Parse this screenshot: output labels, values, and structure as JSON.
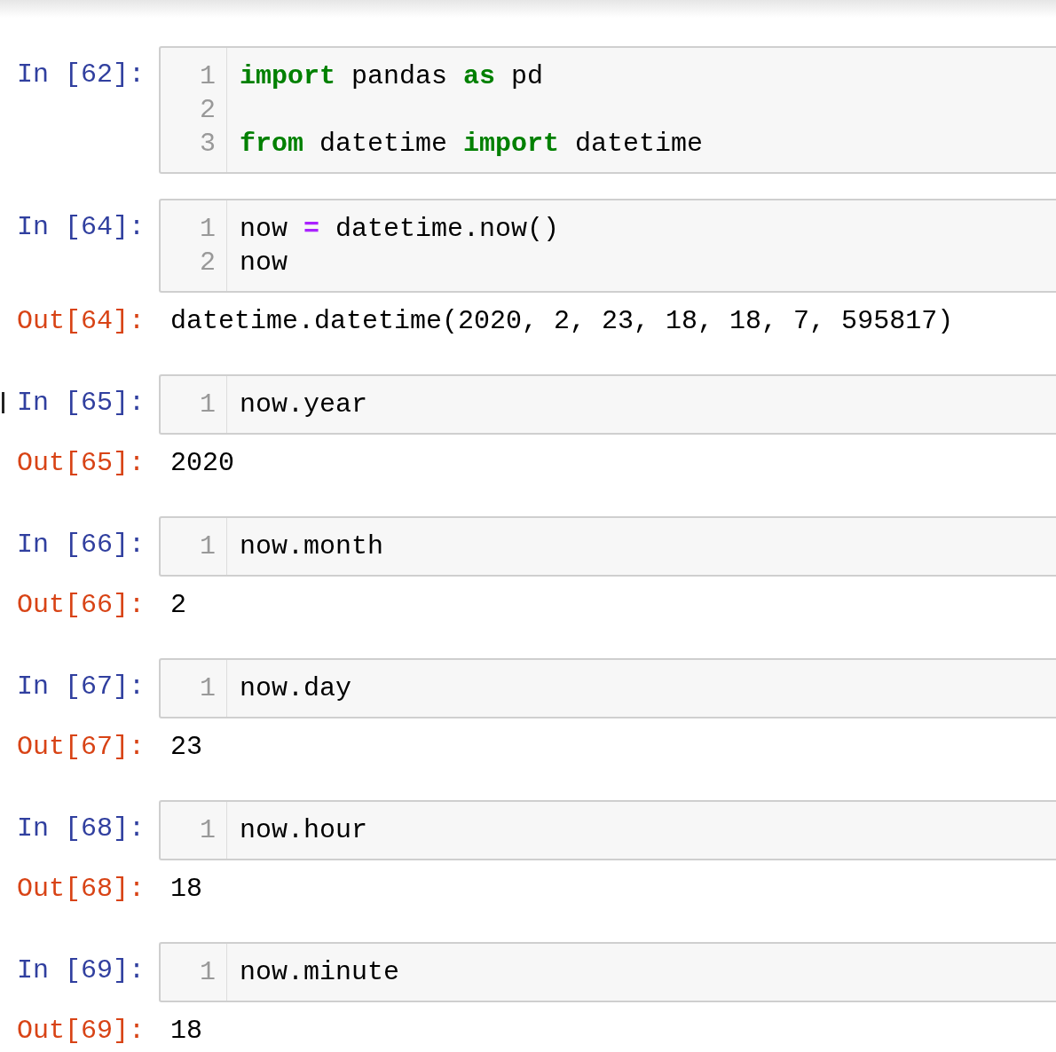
{
  "cells": [
    {
      "prompt": "In [62]:",
      "selected": false,
      "lines": [
        {
          "number": "1",
          "tokens": [
            {
              "text": "import",
              "kind": "keyword"
            },
            {
              "text": " pandas ",
              "kind": "name"
            },
            {
              "text": "as",
              "kind": "keyword"
            },
            {
              "text": " pd",
              "kind": "name"
            }
          ]
        },
        {
          "number": "2"
        },
        {
          "number": "3",
          "tokens": [
            {
              "text": "from",
              "kind": "keyword"
            },
            {
              "text": " datetime ",
              "kind": "name"
            },
            {
              "text": "import",
              "kind": "keyword"
            },
            {
              "text": " datetime",
              "kind": "name"
            }
          ]
        }
      ]
    },
    {
      "prompt": "In [64]:",
      "selected": false,
      "lines": [
        {
          "number": "1",
          "tokens": [
            {
              "text": "now ",
              "kind": "name"
            },
            {
              "text": "=",
              "kind": "operator"
            },
            {
              "text": " datetime.now()",
              "kind": "name"
            }
          ]
        },
        {
          "number": "2",
          "tokens": [
            {
              "text": "now",
              "kind": "name"
            }
          ]
        }
      ],
      "output": {
        "prompt": "Out[64]:",
        "text": "datetime.datetime(2020, 2, 23, 18, 18, 7, 595817)"
      }
    },
    {
      "prompt": "In [65]:",
      "selected": true,
      "lines": [
        {
          "number": "1",
          "tokens": [
            {
              "text": "now.year",
              "kind": "name"
            }
          ]
        }
      ],
      "output": {
        "prompt": "Out[65]:",
        "text": "2020"
      }
    },
    {
      "prompt": "In [66]:",
      "selected": false,
      "lines": [
        {
          "number": "1",
          "tokens": [
            {
              "text": "now.month",
              "kind": "name"
            }
          ]
        }
      ],
      "output": {
        "prompt": "Out[66]:",
        "text": "2"
      }
    },
    {
      "prompt": "In [67]:",
      "selected": false,
      "lines": [
        {
          "number": "1",
          "tokens": [
            {
              "text": "now.day",
              "kind": "name"
            }
          ]
        }
      ],
      "output": {
        "prompt": "Out[67]:",
        "text": "23"
      }
    },
    {
      "prompt": "In [68]:",
      "selected": false,
      "lines": [
        {
          "number": "1",
          "tokens": [
            {
              "text": "now.hour",
              "kind": "name"
            }
          ]
        }
      ],
      "output": {
        "prompt": "Out[68]:",
        "text": "18"
      }
    },
    {
      "prompt": "In [69]:",
      "selected": false,
      "lines": [
        {
          "number": "1",
          "tokens": [
            {
              "text": "now.minute",
              "kind": "name"
            }
          ]
        }
      ],
      "output": {
        "prompt": "Out[69]:",
        "text": "18"
      }
    }
  ]
}
